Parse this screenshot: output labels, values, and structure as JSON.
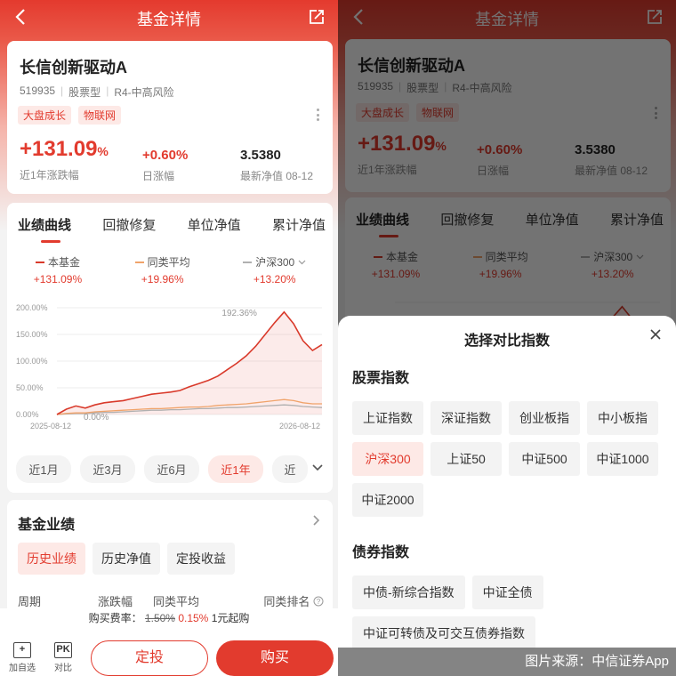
{
  "header": {
    "title": "基金详情"
  },
  "fund": {
    "name": "长信创新驱动A",
    "code": "519935",
    "type": "股票型",
    "risk": "R4-中高风险",
    "tags": [
      "大盘成长",
      "物联网"
    ],
    "return_1y": "+131.09",
    "return_1y_unit": "%",
    "return_1y_label": "近1年涨跌幅",
    "daily_change": "+0.60%",
    "daily_change_label": "日涨幅",
    "nav": "3.5380",
    "nav_label": "最新净值 08-12"
  },
  "perf_tabs": [
    "业绩曲线",
    "回撤修复",
    "单位净值",
    "累计净值"
  ],
  "legend": [
    {
      "name": "本基金",
      "value": "+131.09%",
      "color": "#d93a2b"
    },
    {
      "name": "同类平均",
      "value": "+19.96%",
      "color": "#f0a36a"
    },
    {
      "name": "沪深300",
      "value": "+13.20%",
      "color": "#b0b0b0"
    }
  ],
  "chart_data": {
    "type": "line",
    "y_ticks": [
      "200.00%",
      "150.00%",
      "100.00%",
      "50.00%",
      "0.00%"
    ],
    "ylim": [
      0,
      200
    ],
    "x_start_label": "2025-08-12",
    "x_end_label": "2026-08-12",
    "peak_label": "192.36%",
    "min_label": "0.00%",
    "series": [
      {
        "name": "本基金",
        "values": [
          0,
          10,
          16,
          12,
          18,
          22,
          24,
          26,
          30,
          34,
          38,
          40,
          42,
          45,
          52,
          58,
          64,
          72,
          84,
          96,
          110,
          128,
          150,
          172,
          192,
          170,
          138,
          120,
          131
        ]
      },
      {
        "name": "同类平均",
        "values": [
          0,
          2,
          3,
          3,
          5,
          6,
          7,
          8,
          9,
          10,
          11,
          11,
          12,
          13,
          14,
          14,
          15,
          17,
          18,
          19,
          20,
          22,
          24,
          26,
          28,
          26,
          22,
          20,
          20
        ]
      },
      {
        "name": "沪深300",
        "values": [
          0,
          1,
          2,
          2,
          3,
          4,
          4,
          5,
          6,
          7,
          8,
          8,
          9,
          9,
          10,
          11,
          11,
          12,
          13,
          13,
          14,
          15,
          16,
          17,
          18,
          17,
          15,
          14,
          13
        ]
      }
    ]
  },
  "ranges": [
    "近1月",
    "近3月",
    "近6月",
    "近1年",
    "近"
  ],
  "perf2": {
    "title": "基金业绩",
    "subtabs": [
      "历史业绩",
      "历史净值",
      "定投收益"
    ],
    "cols": [
      "周期",
      "涨跌幅",
      "同类平均",
      "同类排名"
    ]
  },
  "bottom": {
    "fee_label": "购买费率：",
    "fee_old": "1.50%",
    "fee_new": "0.15%",
    "fee_min": "1元起购",
    "add_label": "加自选",
    "pk_box": "PK",
    "pk_label": "对比",
    "ding_label": "定投",
    "buy_label": "购买"
  },
  "sheet": {
    "title": "选择对比指数",
    "stock_title": "股票指数",
    "stock_indices": [
      "上证指数",
      "深证指数",
      "创业板指",
      "中小板指",
      "沪深300",
      "上证50",
      "中证500",
      "中证1000",
      "中证2000"
    ],
    "stock_active": "沪深300",
    "bond_title": "债券指数",
    "bond_indices": [
      "中债-新综合指数",
      "中证全债",
      "中证可转债及可交互债券指数"
    ]
  },
  "credit": "图片来源：中信证券App",
  "colors": {
    "accent": "#e23b2e",
    "accent_bg": "#fde9e6"
  }
}
